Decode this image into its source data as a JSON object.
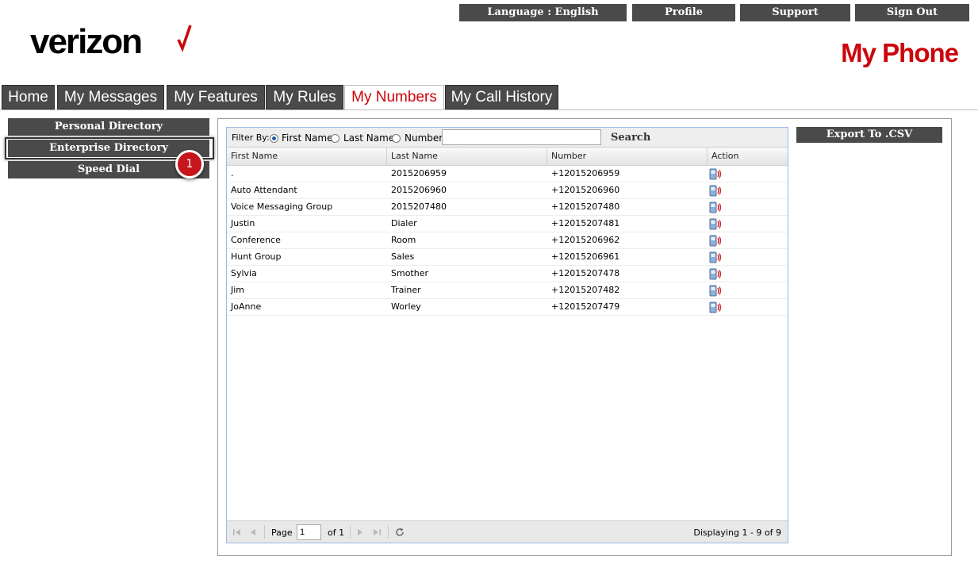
{
  "topnav": {
    "language": "Language : English",
    "profile": "Profile",
    "support": "Support",
    "signout": "Sign Out"
  },
  "brand": {
    "logo_text": "verizon",
    "app_title": "My Phone",
    "accent": "#cd040b"
  },
  "tabs": [
    {
      "label": "Home"
    },
    {
      "label": "My Messages"
    },
    {
      "label": "My Features"
    },
    {
      "label": "My Rules"
    },
    {
      "label": "My Numbers"
    },
    {
      "label": "My Call History"
    }
  ],
  "active_tab": "My Numbers",
  "sidebar": {
    "items": [
      {
        "label": "Personal Directory"
      },
      {
        "label": "Enterprise Directory"
      },
      {
        "label": "Speed Dial"
      }
    ],
    "callout_number": "1"
  },
  "filter": {
    "label": "Filter By:",
    "options": [
      "First Name",
      "Last Name",
      "Number"
    ],
    "selected": "First Name",
    "search_value": "",
    "search_label": "Search"
  },
  "table": {
    "columns": [
      "First Name",
      "Last Name",
      "Number",
      "Action"
    ],
    "rows": [
      {
        "first": ".",
        "last": "2015206959",
        "number": "+12015206959"
      },
      {
        "first": "Auto Attendant",
        "last": "2015206960",
        "number": "+12015206960"
      },
      {
        "first": "Voice Messaging Group",
        "last": "2015207480",
        "number": "+12015207480"
      },
      {
        "first": "Justin",
        "last": "Dialer",
        "number": "+12015207481"
      },
      {
        "first": "Conference",
        "last": "Room",
        "number": "+12015206962"
      },
      {
        "first": "Hunt Group",
        "last": "Sales",
        "number": "+12015206961"
      },
      {
        "first": "Sylvia",
        "last": "Smother",
        "number": "+12015207478"
      },
      {
        "first": "Jim",
        "last": "Trainer",
        "number": "+12015207482"
      },
      {
        "first": "JoAnne",
        "last": "Worley",
        "number": "+12015207479"
      }
    ],
    "action_icon": "call-phone-icon"
  },
  "pager": {
    "page_label": "Page",
    "page_value": "1",
    "of_label": "of 1",
    "display_text": "Displaying 1 - 9 of 9"
  },
  "export_label": "Export To .CSV"
}
